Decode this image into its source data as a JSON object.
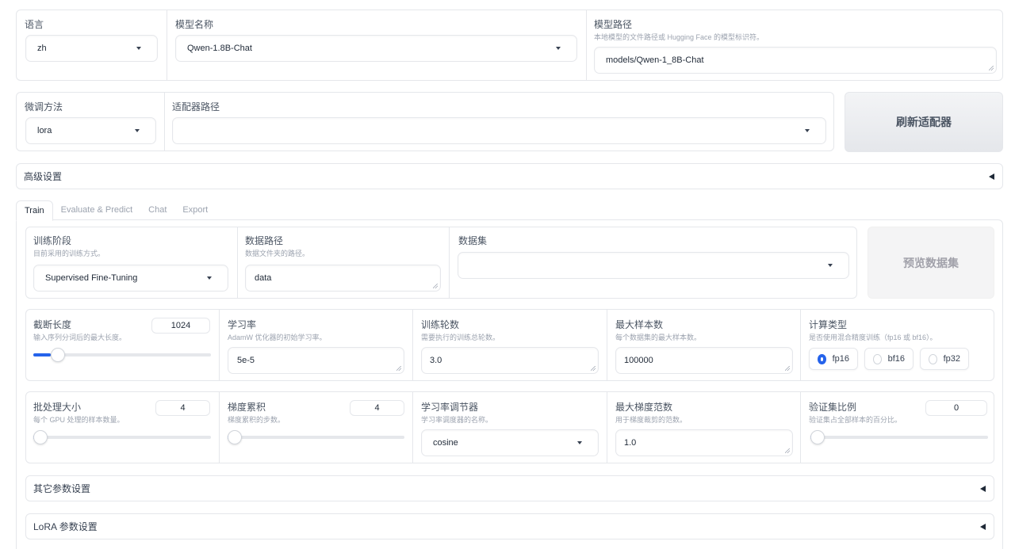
{
  "top_row": {
    "language": {
      "label": "语言",
      "value": "zh"
    },
    "model_name": {
      "label": "模型名称",
      "value": "Qwen-1.8B-Chat"
    },
    "model_path": {
      "label": "模型路径",
      "info": "本地模型的文件路径或 Hugging Face 的模型标识符。",
      "value": "models/Qwen-1_8B-Chat"
    }
  },
  "second_row": {
    "finetuning_type": {
      "label": "微调方法",
      "value": "lora"
    },
    "adapter_path": {
      "label": "适配器路径",
      "value": ""
    },
    "refresh_button": "刷新适配器"
  },
  "advanced_settings": {
    "label": "高级设置",
    "collapsed": true
  },
  "tabs": [
    {
      "label": "Train",
      "active": true
    },
    {
      "label": "Evaluate & Predict",
      "active": false
    },
    {
      "label": "Chat",
      "active": false
    },
    {
      "label": "Export",
      "active": false
    }
  ],
  "train": {
    "stage": {
      "label": "训练阶段",
      "info": "目前采用的训练方式。",
      "value": "Supervised Fine-Tuning"
    },
    "dataset_dir": {
      "label": "数据路径",
      "info": "数据文件夹的路径。",
      "value": "data"
    },
    "dataset": {
      "label": "数据集",
      "value": ""
    },
    "preview_button": "预览数据集",
    "cutoff_len": {
      "label": "截断长度",
      "info": "输入序列分词后的最大长度。",
      "value": "1024",
      "slider_fraction": 0.1
    },
    "learning_rate": {
      "label": "学习率",
      "info": "AdamW 优化器的初始学习率。",
      "value": "5e-5"
    },
    "num_epochs": {
      "label": "训练轮数",
      "info": "需要执行的训练总轮数。",
      "value": "3.0"
    },
    "max_samples": {
      "label": "最大样本数",
      "info": "每个数据集的最大样本数。",
      "value": "100000"
    },
    "compute_type": {
      "label": "计算类型",
      "info": "是否使用混合精度训练（fp16 或 bf16）。",
      "options": [
        "fp16",
        "bf16",
        "fp32"
      ],
      "selected": "fp16"
    },
    "batch_size": {
      "label": "批处理大小",
      "info": "每个 GPU 处理的样本数量。",
      "value": "4",
      "slider_fraction": 0.0
    },
    "grad_accum": {
      "label": "梯度累积",
      "info": "梯度累积的步数。",
      "value": "4",
      "slider_fraction": 0.0
    },
    "lr_scheduler": {
      "label": "学习率调节器",
      "info": "学习率调度器的名称。",
      "value": "cosine"
    },
    "max_grad_norm": {
      "label": "最大梯度范数",
      "info": "用于梯度裁剪的范数。",
      "value": "1.0"
    },
    "val_size": {
      "label": "验证集比例",
      "info": "验证集占全部样本的百分比。",
      "value": "0",
      "slider_fraction": 0.0
    },
    "extra_settings": {
      "label": "其它参数设置",
      "collapsed": true
    },
    "lora_settings": {
      "label": "LoRA 参数设置",
      "collapsed": true
    }
  }
}
